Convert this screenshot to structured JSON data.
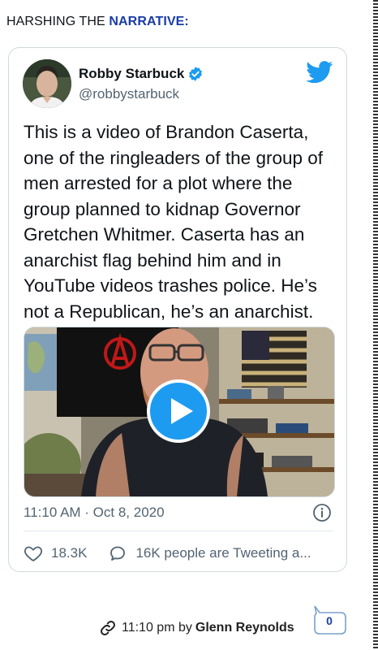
{
  "post": {
    "heading_prefix": "HARSHING THE ",
    "heading_link": "NARRATIVE:",
    "footer_time": "11:10 pm by ",
    "footer_author": "Glenn Reynolds",
    "comment_count": "0"
  },
  "tweet": {
    "author_name": "Robby Starbuck",
    "author_handle": "@robbystarbuck",
    "text": "This is a video of Brandon Caserta, one of the ringleaders of the group of men arrested for a plot where the group planned to kidnap Governor Gretchen Whitmer. Caserta has an anarchist flag behind him and in YouTube videos trashes police. He’s not a Republican, he’s an anarchist.",
    "timestamp": "11:10 AM · Oct 8, 2020",
    "likes": "18.3K",
    "tweeting": "16K people are Tweeting a...",
    "verified_icon": "verified-badge-icon",
    "logo_icon": "twitter-bird-icon"
  },
  "colors": {
    "link": "#1a3ca8",
    "twitter_blue": "#1d9bf0",
    "muted": "#536471",
    "border": "#cfd9de"
  }
}
